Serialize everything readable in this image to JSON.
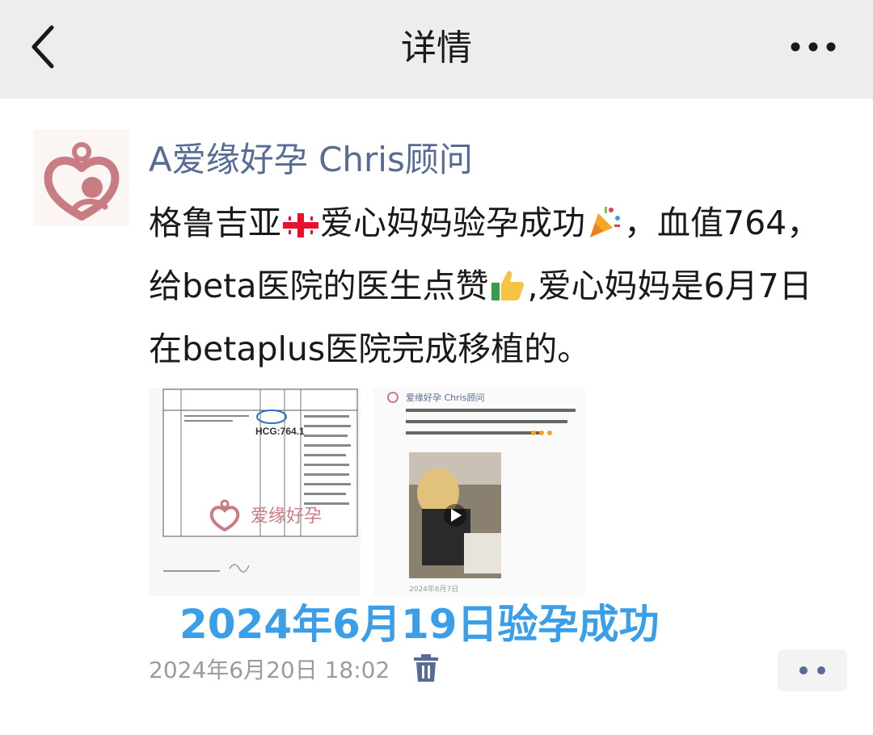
{
  "header": {
    "title": "详情",
    "back_icon": "chevron-left-icon",
    "more_icon": "more-horizontal-icon"
  },
  "post": {
    "author": "A爱缘好孕 Chris顾问",
    "content": {
      "part1": "格鲁吉亚",
      "part2": "爱心妈妈验孕成功",
      "part3": "，血值764，给beta医院的医生点赞",
      "part4": ",爱心妈妈是6月7日在betaplus医院完成移植的。"
    },
    "emojis": [
      "georgia-flag-icon",
      "party-popper-icon",
      "thumbs-up-icon"
    ],
    "images": [
      {
        "hcg_text": "HCG:764.1",
        "watermark": "爱缘好孕"
      },
      {
        "author_line": "爱缘好孕 Chris顾问",
        "text": "格鲁吉亚爱心妈妈6月7日在Betaplus医院顺利完成移植，期待2周内自信验孕结果，爱心妈妈鼓足勇气加油！",
        "date": "2024年6月7日"
      }
    ],
    "caption": "2024年6月19日验孕成功",
    "timestamp": "2024年6月20日 18:02"
  },
  "colors": {
    "header_bg": "#ededed",
    "author_link": "#576b95",
    "caption_blue": "#3a9fe8",
    "timestamp_gray": "#9b9b9b",
    "logo_pink": "#c97c82"
  }
}
